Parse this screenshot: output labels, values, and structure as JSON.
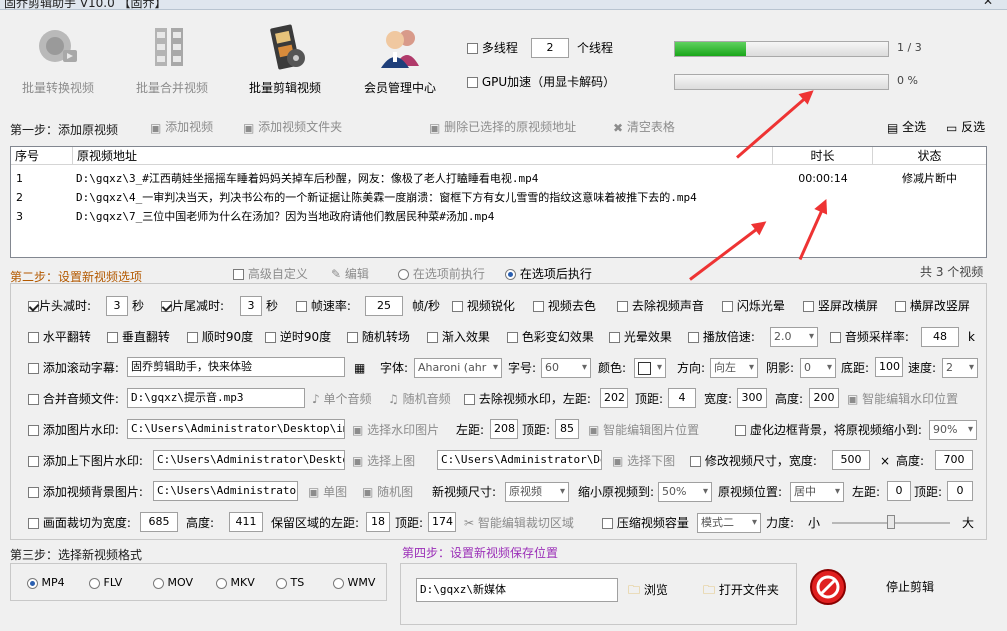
{
  "window": {
    "title": "固乔剪辑助手 V10.0 【固乔】"
  },
  "toolbar": {
    "items": [
      {
        "label": "批量转换视频",
        "enabled": false
      },
      {
        "label": "批量合并视频",
        "enabled": false
      },
      {
        "label": "批量剪辑视频",
        "enabled": true
      },
      {
        "label": "会员管理中心",
        "enabled": true
      }
    ]
  },
  "threads": {
    "checkbox_label": "多线程",
    "value": "2",
    "unit": "个线程"
  },
  "gpu": {
    "checkbox_label": "GPU加速（用显卡解码）"
  },
  "progress": [
    {
      "value": 0.333,
      "text": "1 / 3"
    },
    {
      "value": 0,
      "text": "0 %"
    }
  ],
  "step1": {
    "label": "第一步：添加原视频",
    "add_video": "添加视频",
    "add_folder": "添加视频文件夹",
    "delete_selected": "删除已选择的原视频地址",
    "clear_table": "清空表格",
    "select_all": "全选",
    "invert": "反选"
  },
  "table": {
    "headers": [
      "序号",
      "原视频地址",
      "时长",
      "状态"
    ],
    "rows": [
      {
        "no": "1",
        "path": "D:\\gqxz\\3_#江西萌娃坐摇摇车睡着妈妈关掉车后秒醒，网友：像极了老人打瞌睡看电视.mp4",
        "duration": "00:00:14",
        "status": "修减片断中"
      },
      {
        "no": "2",
        "path": "D:\\gqxz\\4_一审判决当天，判决书公布的一个新证据让陈美霖一度崩溃：窗框下方有女儿雪雪的指纹这意味着被推下去的.mp4",
        "duration": "",
        "status": ""
      },
      {
        "no": "3",
        "path": "D:\\gqxz\\7_三位中国老师为什么在汤加？因为当地政府请他们教居民种菜#汤加.mp4",
        "duration": "",
        "status": ""
      }
    ]
  },
  "step2": {
    "label": "第二步：设置新视频选项",
    "advanced": "高级自定义",
    "edit": "编辑",
    "before": "在选项前执行",
    "after": "在选项后执行",
    "count": "共 3 个视频"
  },
  "opts": {
    "head_cut": "片头减时:",
    "head_val": "3",
    "sec1": "秒",
    "tail_cut": "片尾减时:",
    "tail_val": "3",
    "sec2": "秒",
    "framerate": "帧速率:",
    "framerate_val": "25",
    "fps_unit": "帧/秒",
    "sharpen": "视频锐化",
    "decolor": "视频去色",
    "remove_audio": "去除视频声音",
    "flash": "闪烁光晕",
    "v2h": "竖屏改横屏",
    "h2v": "横屏改竖屏",
    "hflip": "水平翻转",
    "vflip": "垂直翻转",
    "cw90": "顺时90度",
    "ccw90": "逆时90度",
    "random_trans": "随机转场",
    "fade_in": "渐入效果",
    "color_fx": "色彩变幻效果",
    "halo": "光晕效果",
    "speed": "播放倍速:",
    "speed_val": "2.0",
    "sample_rate": "音频采样率:",
    "sample_val": "48",
    "k": "k",
    "scroll_sub": "添加滚动字幕:",
    "scroll_text": "固乔剪辑助手，快来体验",
    "font": "字体:",
    "font_val": "Aharoni (ahr",
    "size": "字号:",
    "size_val": "60",
    "color": "颜色:",
    "direction": "方向:",
    "direction_val": "向左",
    "shadow": "阴影:",
    "shadow_val": "0",
    "bottom": "底距:",
    "bottom_val": "100",
    "speed2": "速度:",
    "speed2_val": "2",
    "merge_audio": "合并音频文件:",
    "audio_path": "D:\\gqxz\\提示音.mp3",
    "single_audio": "单个音频",
    "random_audio": "随机音频",
    "remove_wm": "去除视频水印，左距:",
    "wm_left": "202",
    "top": "顶距:",
    "wm_top": "4",
    "width": "宽度:",
    "wm_w": "300",
    "height": "高度:",
    "wm_h": "200",
    "smart_wm": "智能编辑水印位置",
    "img_wm": "添加图片水印:",
    "img_wm_path": "C:\\Users\\Administrator\\Desktop\\img-q",
    "choose_wm": "选择水印图片",
    "left": "左距:",
    "img_left": "208",
    "top2": "顶距:",
    "img_top": "85",
    "smart_img": "智能编辑图片位置",
    "blur_bg": "虚化边框背景，将原视频缩小到:",
    "blur_val": "90%",
    "tb_wm": "添加上下图片水印:",
    "top_img_path": "C:\\Users\\Administrator\\Desktop\\i",
    "choose_top": "选择上图",
    "bottom_img_path": "C:\\Users\\Administrator\\Desk",
    "choose_bottom": "选择下图",
    "resize": "修改视频尺寸，宽度:",
    "resize_w": "500",
    "times": "×",
    "height2": "高度:",
    "resize_h": "700",
    "bg_img": "添加视频背景图片:",
    "bg_path": "C:\\Users\\Administrator\\D",
    "single_img": "单图",
    "random_img": "随机图",
    "new_size": "新视频尺寸:",
    "new_size_val": "原视频",
    "shrink": "缩小原视频到:",
    "shrink_val": "50%",
    "orig_pos": "原视频位置:",
    "orig_pos_val": "居中",
    "left3": "左距:",
    "bg_left": "0",
    "top3": "顶距:",
    "bg_top": "0",
    "crop": "画面裁切为宽度:",
    "crop_w": "685",
    "height3": "高度:",
    "crop_h": "411",
    "keep_left": "保留区域的左距:",
    "crop_left": "18",
    "top4": "顶距:",
    "crop_top": "174",
    "smart_crop": "智能编辑裁切区域",
    "compress": "压缩视频容量",
    "mode_val": "模式二",
    "force": "力度:",
    "small": "小",
    "big": "大",
    "force_level": 0.5
  },
  "step3": {
    "label": "第三步：选择新视频格式",
    "formats": [
      "MP4",
      "FLV",
      "MOV",
      "MKV",
      "TS",
      "WMV"
    ]
  },
  "step4": {
    "label": "第四步：设置新视频保存位置",
    "path": "D:\\gqxz\\新媒体",
    "browse": "浏览",
    "open_folder": "打开文件夹"
  },
  "stop": {
    "label": "停止剪辑"
  },
  "colors": {
    "progress_fill": "#1aa61a",
    "arrow": "#ee3333",
    "step4_label": "#9b30b8",
    "step2_label": "#b35900"
  }
}
